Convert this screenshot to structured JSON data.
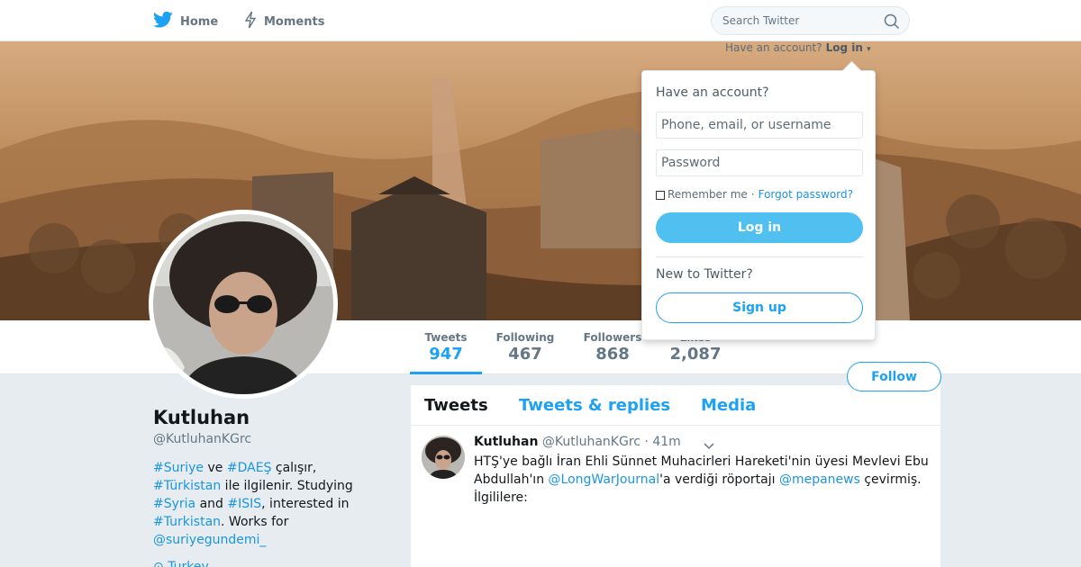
{
  "nav": {
    "home_label": "Home",
    "moments_label": "Moments",
    "search_placeholder": "Search Twitter"
  },
  "login_prompt": {
    "text": "Have an account?",
    "link": "Log in"
  },
  "profile": {
    "name": "Kutluhan",
    "handle": "@KutluhanKGrc",
    "bio": [
      {
        "text": "#Suriye",
        "link": true
      },
      {
        "text": " ve ",
        "link": false
      },
      {
        "text": "#DAEŞ",
        "link": true
      },
      {
        "text": " çalışır, ",
        "link": false
      },
      {
        "text": "#Türkistan",
        "link": true
      },
      {
        "text": " ile ilgilenir. Studying ",
        "link": false
      },
      {
        "text": "#Syria",
        "link": true
      },
      {
        "text": " and ",
        "link": false
      },
      {
        "text": "#ISIS",
        "link": true
      },
      {
        "text": ", interested in ",
        "link": false
      },
      {
        "text": "#Turkistan",
        "link": true
      },
      {
        "text": ". Works for ",
        "link": false
      },
      {
        "text": "@suriyegundemi_",
        "link": true
      }
    ],
    "location": "Turkey"
  },
  "stats": {
    "tweets": {
      "label": "Tweets",
      "value": "947"
    },
    "following": {
      "label": "Following",
      "value": "467"
    },
    "followers": {
      "label": "Followers",
      "value": "868"
    },
    "likes": {
      "label": "Likes",
      "value": "2,087"
    }
  },
  "follow_label": "Follow",
  "timeline": {
    "tabs": [
      "Tweets",
      "Tweets & replies",
      "Media"
    ],
    "tweet": {
      "author": "Kutluhan",
      "handle": "@KutluhanKGrc",
      "time": "· 41m",
      "text": [
        {
          "text": "HTŞ'ye bağlı İran Ehli Sünnet Muhacirleri Hareketi'nin üyesi Mevlevi Ebu Abdullah'ın ",
          "link": false
        },
        {
          "text": "@LongWarJournal",
          "link": true
        },
        {
          "text": "'a verdiği röportajı ",
          "link": false
        },
        {
          "text": "@mepanews",
          "link": true
        },
        {
          "text": " çevirmiş. İlgililere:",
          "link": false
        }
      ]
    }
  },
  "login_dropdown": {
    "title": "Have an account?",
    "username_placeholder": "Phone, email, or username",
    "password_placeholder": "Password",
    "remember_label": "Remember me",
    "separator": "·",
    "forgot_label": "Forgot password?",
    "login_button": "Log in",
    "new_prompt": "New to Twitter?",
    "signup_button": "Sign up"
  },
  "colors": {
    "accent": "#1da1f2",
    "link": "#1b95e0",
    "login_button_bg": "#4fc0ef",
    "page_bg": "#e6ecf0"
  },
  "icons": [
    "twitter-bird-icon",
    "lightning-icon",
    "search-icon",
    "chevron-down-icon",
    "location-pin-icon"
  ]
}
